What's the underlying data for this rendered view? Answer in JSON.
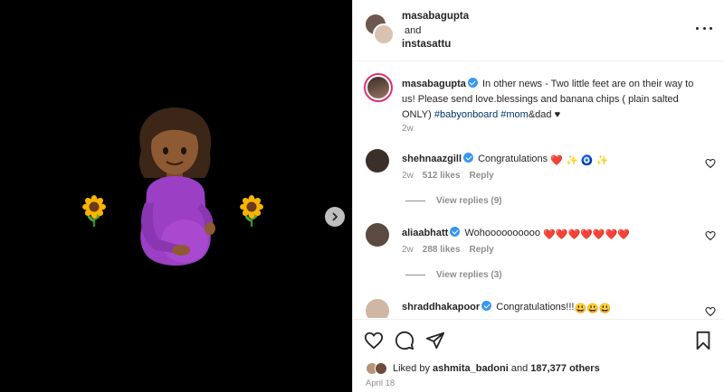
{
  "header": {
    "user1": "masabagupta",
    "and": "and",
    "user2": "instasattu"
  },
  "caption": {
    "username": "masabagupta",
    "text": " In other news - Two little feet are on their way to us! Please send love.blessings and banana chips ( plain salted ONLY) ",
    "tag1": "#babyonboard",
    "tag2": "#mom",
    "tail": "&dad ♥",
    "time": "2w"
  },
  "comments": [
    {
      "username": "shehnaazgill",
      "text": "Congratulations",
      "emojis": "❤️ ✨ 🧿 ✨",
      "time": "2w",
      "likes": "512 likes",
      "reply": "Reply",
      "view_replies": "View replies (9)"
    },
    {
      "username": "aliaabhatt",
      "text": "Wohoooooooooo",
      "emojis": "❤️❤️❤️❤️❤️❤️❤️",
      "time": "2w",
      "likes": "288 likes",
      "reply": "Reply",
      "view_replies": "View replies (3)"
    },
    {
      "username": "shraddhakapoor",
      "text": "Congratulations!!!",
      "emojis": "😃😃😃"
    }
  ],
  "likes": {
    "prefix": "Liked by ",
    "user": "ashmita_badoni",
    "middle": " and ",
    "count": "187,377 others"
  },
  "date": "April 18",
  "icons": {
    "media": [
      "sunflower-icon",
      "pregnant-woman-emoji",
      "chevron-right-icon"
    ],
    "actions": [
      "heart-icon",
      "comment-icon",
      "share-icon",
      "bookmark-icon"
    ],
    "more": "more-options-icon"
  },
  "colors": {
    "verified": "#3897f0",
    "hashtag": "#00376b",
    "media_bg": "#000000",
    "heart_red": "#ed4956"
  }
}
